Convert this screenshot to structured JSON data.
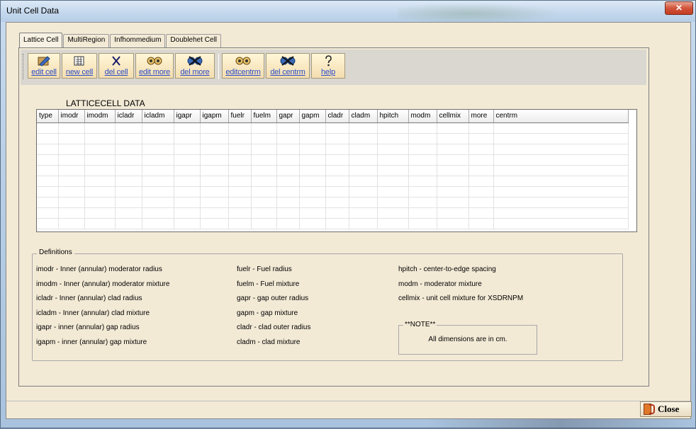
{
  "window": {
    "title": "Unit Cell Data",
    "close_glyph": "✕"
  },
  "tabs": [
    {
      "label": "Lattice Cell",
      "active": true
    },
    {
      "label": "MultiRegion",
      "active": false
    },
    {
      "label": "Infhommedium",
      "active": false
    },
    {
      "label": "Doublehet Cell",
      "active": false
    }
  ],
  "toolbar": {
    "buttons": [
      {
        "label": "edit cell",
        "icon": "edit-cell-icon"
      },
      {
        "label": "new cell",
        "icon": "new-cell-icon"
      },
      {
        "label": "del cell",
        "icon": "delete-cell-icon"
      },
      {
        "label": "edit more",
        "icon": "edit-more-icon"
      },
      {
        "label": "del more",
        "icon": "delete-more-icon"
      },
      {
        "label": "editcentrm",
        "icon": "edit-centrm-icon"
      },
      {
        "label": "del centrm",
        "icon": "delete-centrm-icon"
      },
      {
        "label": "help",
        "icon": "help-icon"
      }
    ]
  },
  "grid": {
    "title": "LATTICECELL DATA",
    "columns": [
      "type",
      "imodr",
      "imodm",
      "icladr",
      "icladm",
      "igapr",
      "igapm",
      "fuelr",
      "fuelm",
      "gapr",
      "gapm",
      "cladr",
      "cladm",
      "hpitch",
      "modm",
      "cellmix",
      "more",
      "centrm"
    ],
    "rows": []
  },
  "definitions": {
    "legend": "Definitions",
    "col1": [
      "imodr  - Inner (annular) moderator radius",
      "imodm - Inner (annular) moderator mixture",
      "icladr  - Inner (annular) clad radius",
      "icladm - Inner (annular) clad mixture",
      "igapr    - inner (annular) gap radius",
      "igapm  - inner (annular) gap mixture"
    ],
    "col2": [
      "fuelr   - Fuel radius",
      "fuelm  - Fuel mixture",
      "gapr    - gap outer radius",
      "gapm  - gap mixture",
      "cladr   - clad outer radius",
      "cladm - clad mixture"
    ],
    "col3": [
      "hpitch - center-to-edge spacing",
      "modm - moderator mixture",
      "cellmix - unit cell mixture for XSDRNPM"
    ],
    "note_legend": "**NOTE**",
    "note_text": "All dimensions are in cm."
  },
  "footer": {
    "close_label": "Close"
  }
}
